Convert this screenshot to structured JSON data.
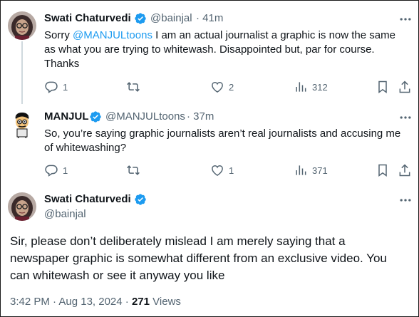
{
  "tweets": [
    {
      "name": "Swati Chaturvedi",
      "handle": "@bainjal",
      "time": "· 41m",
      "text_pre": "Sorry ",
      "mention": "@MANJULtoons",
      "text_line1_post": " I am an actual journalist a graphic is now the same",
      "text_line2": "as what you are trying to whitewash. Disappointed but, par for course.",
      "text_line3": "Thanks",
      "replies": "1",
      "retweets": "",
      "likes": "2",
      "views": "312"
    },
    {
      "name": "MANJUL",
      "handle": "@MANJULtoons",
      "time": "· 37m",
      "text_line1": "So, you’re saying graphic journalists aren’t real journalists and accusing me",
      "text_line2": "of whitewashing?",
      "replies": "1",
      "retweets": "",
      "likes": "1",
      "views": "371"
    }
  ],
  "main_tweet": {
    "name": "Swati Chaturvedi",
    "handle": "@bainjal",
    "text_line1": "Sir, please don’t deliberately mislead I am merely saying that a",
    "text_line2": "newspaper graphic is somewhat different from an exclusive video. You",
    "text_line3": "can whitewash or see it anyway you like",
    "timestamp": "3:42 PM · Aug 13, 2024 ·",
    "view_count": "271",
    "views_label": "Views"
  },
  "colors": {
    "accent": "#1d9bf0",
    "secondary_text": "#536471",
    "primary_text": "#0f1419"
  },
  "icons": [
    "reply-icon",
    "retweet-icon",
    "like-icon",
    "views-icon",
    "bookmark-icon",
    "share-icon",
    "verified-badge-icon",
    "more-options-icon"
  ]
}
